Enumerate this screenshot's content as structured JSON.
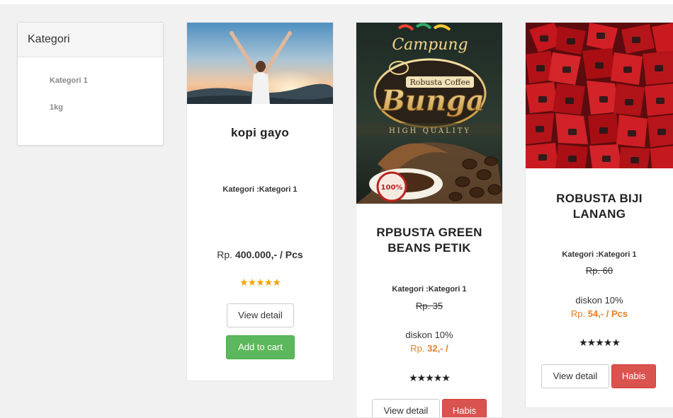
{
  "sidebar": {
    "title": "Kategori",
    "items": [
      {
        "label": "Kategori 1"
      },
      {
        "label": "1kg"
      }
    ]
  },
  "products": [
    {
      "name": "kopi gayo",
      "category_text": "Kategori :Kategori 1",
      "price_prefix": "Rp. ",
      "price_value": "400.000,- / Pcs",
      "rating_stars": "★★★★★",
      "rating_color": "#f0a500",
      "view_label": "View detail",
      "action_label": "Add to cart",
      "image": "woman-arms-raised-sunrise"
    },
    {
      "name_line1": "RPBUSTA GREEN",
      "name_line2": "BEANS PETIK",
      "category_text": "Kategori :Kategori 1",
      "old_price": "Rp. 35",
      "discount": "diskon 10%",
      "price_prefix": "Rp. ",
      "price_value": "32,- /",
      "rating_stars": "★★★★★",
      "rating_color": "#222222",
      "view_label": "View detail",
      "action_label": "Habis",
      "image": "robusta-coffee-bunga-package",
      "package_texts": {
        "brand_top": "Campung",
        "label_small": "Robusta Coffee",
        "brand_main": "Bunga",
        "quality": "HIGH QUALITY",
        "seal": "100%"
      }
    },
    {
      "name_line1": "ROBUSTA BIJI",
      "name_line2": "LANANG",
      "category_text": "Kategori :Kategori 1",
      "old_price": "Rp. 60",
      "discount": "diskon 10%",
      "price_prefix": "Rp. ",
      "price_value": "54,- / Pcs",
      "rating_stars": "★★★★★",
      "rating_color": "#222222",
      "view_label": "View detail",
      "action_label": "Habis",
      "image": "red-coffee-packs-pile"
    }
  ],
  "colors": {
    "accent_orange": "#e67e22",
    "success": "#5cb85c",
    "danger": "#d9534f"
  }
}
